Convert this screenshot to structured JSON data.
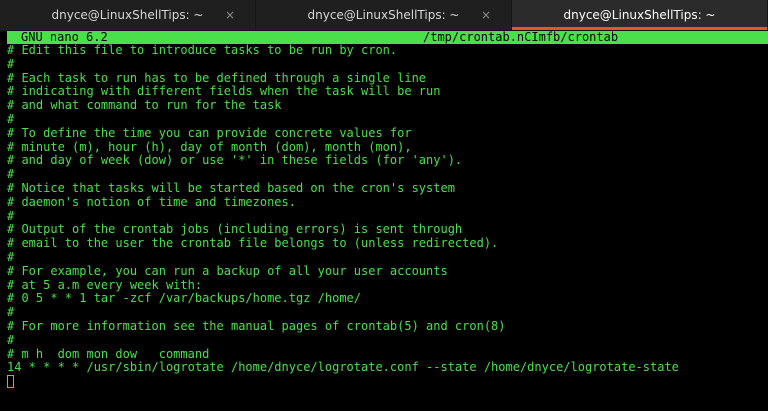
{
  "tabs": [
    {
      "title": "dnyce@LinuxShellTips: ~",
      "close": "×",
      "active": false
    },
    {
      "title": "dnyce@LinuxShellTips: ~",
      "close": "×",
      "active": false
    },
    {
      "title": "dnyce@LinuxShellTips: ~",
      "close": "",
      "active": true
    }
  ],
  "editor": {
    "version": "GNU nano 6.2",
    "filename": "/tmp/crontab.nCImfb/crontab"
  },
  "lines": [
    "# Edit this file to introduce tasks to be run by cron.",
    "#",
    "# Each task to run has to be defined through a single line",
    "# indicating with different fields when the task will be run",
    "# and what command to run for the task",
    "#",
    "# To define the time you can provide concrete values for",
    "# minute (m), hour (h), day of month (dom), month (mon),",
    "# and day of week (dow) or use '*' in these fields (for 'any').",
    "#",
    "# Notice that tasks will be started based on the cron's system",
    "# daemon's notion of time and timezones.",
    "#",
    "# Output of the crontab jobs (including errors) is sent through",
    "# email to the user the crontab file belongs to (unless redirected).",
    "#",
    "# For example, you can run a backup of all your user accounts",
    "# at 5 a.m every week with:",
    "# 0 5 * * 1 tar -zcf /var/backups/home.tgz /home/",
    "#",
    "# For more information see the manual pages of crontab(5) and cron(8)",
    "#",
    "# m h  dom mon dow   command",
    "14 * * * * /usr/sbin/logrotate /home/dnyce/logrotate.conf --state /home/dnyce/logrotate-state"
  ],
  "colors": {
    "accent": "#e95420",
    "terminal_text": "#4ae04a",
    "terminal_bg": "#000000",
    "tabbar_bg": "#1f1f1f"
  }
}
